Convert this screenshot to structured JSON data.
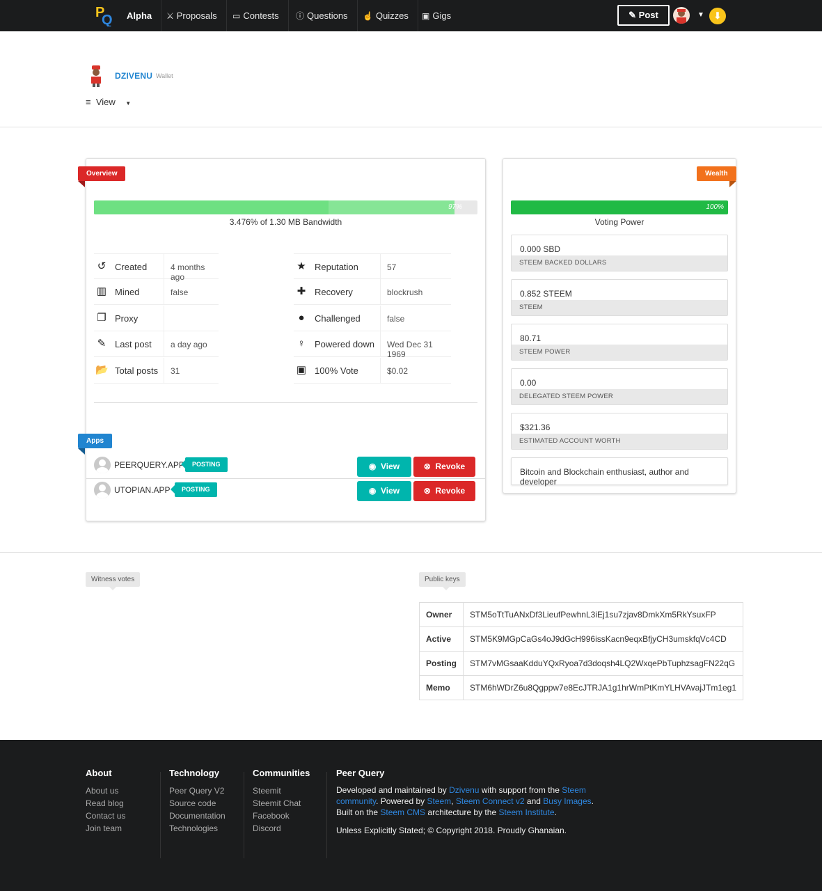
{
  "nav": {
    "brand": "Alpha",
    "items": [
      {
        "label": "Proposals",
        "icon": "handshake-icon"
      },
      {
        "label": "Contests",
        "icon": "gamepad-icon"
      },
      {
        "label": "Questions",
        "icon": "question-circle-icon"
      },
      {
        "label": "Quizzes",
        "icon": "hand-pointer-icon"
      },
      {
        "label": "Gigs",
        "icon": "money-icon"
      }
    ],
    "post_label": "Post"
  },
  "profile": {
    "name": "DZIVENU",
    "subtitle": "Wallet",
    "view_label": "View"
  },
  "overview": {
    "ribbon": "Overview",
    "bandwidth_percent": 97,
    "bandwidth_label": "97%",
    "bandwidth_text": "3.476% of 1.30 MB Bandwidth",
    "left_stats": [
      {
        "key": "Created",
        "value": "4 months ago",
        "icon": "history-icon"
      },
      {
        "key": "Mined",
        "value": "false",
        "icon": "microchip-icon"
      },
      {
        "key": "Proxy",
        "value": "",
        "icon": "clone-icon"
      },
      {
        "key": "Last post",
        "value": "a day ago",
        "icon": "pencil-icon"
      },
      {
        "key": "Total posts",
        "value": "31",
        "icon": "folder-open-icon"
      }
    ],
    "right_stats": [
      {
        "key": "Reputation",
        "value": "57",
        "icon": "star-icon"
      },
      {
        "key": "Recovery",
        "value": "blockrush",
        "icon": "ambulance-icon"
      },
      {
        "key": "Challenged",
        "value": "false",
        "icon": "bomb-icon"
      },
      {
        "key": "Powered down",
        "value": "Wed Dec 31 1969",
        "icon": "fire-extinguisher-icon"
      },
      {
        "key": "100% Vote",
        "value": "$0.02",
        "icon": "money-bill-icon"
      }
    ]
  },
  "apps": {
    "ribbon": "Apps",
    "items": [
      {
        "name": "PEERQUERY.APP",
        "tag": "POSTING",
        "view": "View",
        "revoke": "Revoke"
      },
      {
        "name": "UTOPIAN.APP",
        "tag": "POSTING",
        "view": "View",
        "revoke": "Revoke"
      }
    ]
  },
  "wealth": {
    "ribbon": "Wealth",
    "voting_percent": 100,
    "voting_label": "100%",
    "voting_text": "Voting Power",
    "boxes": [
      {
        "value": "0.000 SBD",
        "label": "STEEM BACKED DOLLARS"
      },
      {
        "value": "0.852 STEEM",
        "label": "STEEM"
      },
      {
        "value": "80.71",
        "label": "STEEM POWER"
      },
      {
        "value": "0.00",
        "label": "DELEGATED STEEM POWER"
      },
      {
        "value": "$321.36",
        "label": "ESTIMATED ACCOUNT WORTH"
      }
    ],
    "bio": "Bitcoin and Blockchain enthusiast, author and developer"
  },
  "witness": {
    "tag": "Witness votes"
  },
  "keys": {
    "tag": "Public keys",
    "rows": [
      {
        "k": "Owner",
        "v": "STM5oTtTuANxDf3LieufPewhnL3iEj1su7zjav8DmkXm5RkYsuxFP"
      },
      {
        "k": "Active",
        "v": "STM5K9MGpCaGs4oJ9dGcH996issKacn9eqxBfjyCH3umskfqVc4CD"
      },
      {
        "k": "Posting",
        "v": "STM7vMGsaaKdduYQxRyoa7d3doqsh4LQ2WxqePbTuphzsagFN22qG"
      },
      {
        "k": "Memo",
        "v": "STM6hWDrZ6u8Qgppw7e8EcJTRJA1g1hrWmPtKmYLHVAvajJTm1eg1"
      }
    ]
  },
  "footer": {
    "about": {
      "title": "About",
      "links": [
        "About us",
        "Read blog",
        "Contact us",
        "Join team"
      ]
    },
    "technology": {
      "title": "Technology",
      "links": [
        "Peer Query V2",
        "Source code",
        "Documentation",
        "Technologies"
      ]
    },
    "communities": {
      "title": "Communities",
      "links": [
        "Steemit",
        "Steemit Chat",
        "Facebook",
        "Discord"
      ]
    },
    "pq": {
      "title": "Peer Query",
      "t1": "Developed and maintained by ",
      "l1": "Dzivenu",
      "t2": " with support from the ",
      "l2": "Steem community",
      "t3": ". Powered by ",
      "l3": "Steem",
      "t4": ", ",
      "l4": "Steem Connect v2",
      "t5": " and ",
      "l5": "Busy Images",
      "t6": ". Built on the ",
      "l6": "Steem CMS",
      "t7": " architecture by the ",
      "l7": "Steem Institute",
      "t8": ".",
      "copyright": "Unless Explicitly Stated; © Copyright 2018. Proudly Ghanaian."
    }
  },
  "colors": {
    "nav_bg": "#1b1c1d",
    "green": "#21ba45",
    "light_green": "#6ee082",
    "red": "#db2828",
    "orange": "#f2711c",
    "blue": "#2185d0",
    "teal": "#00b5ad"
  }
}
